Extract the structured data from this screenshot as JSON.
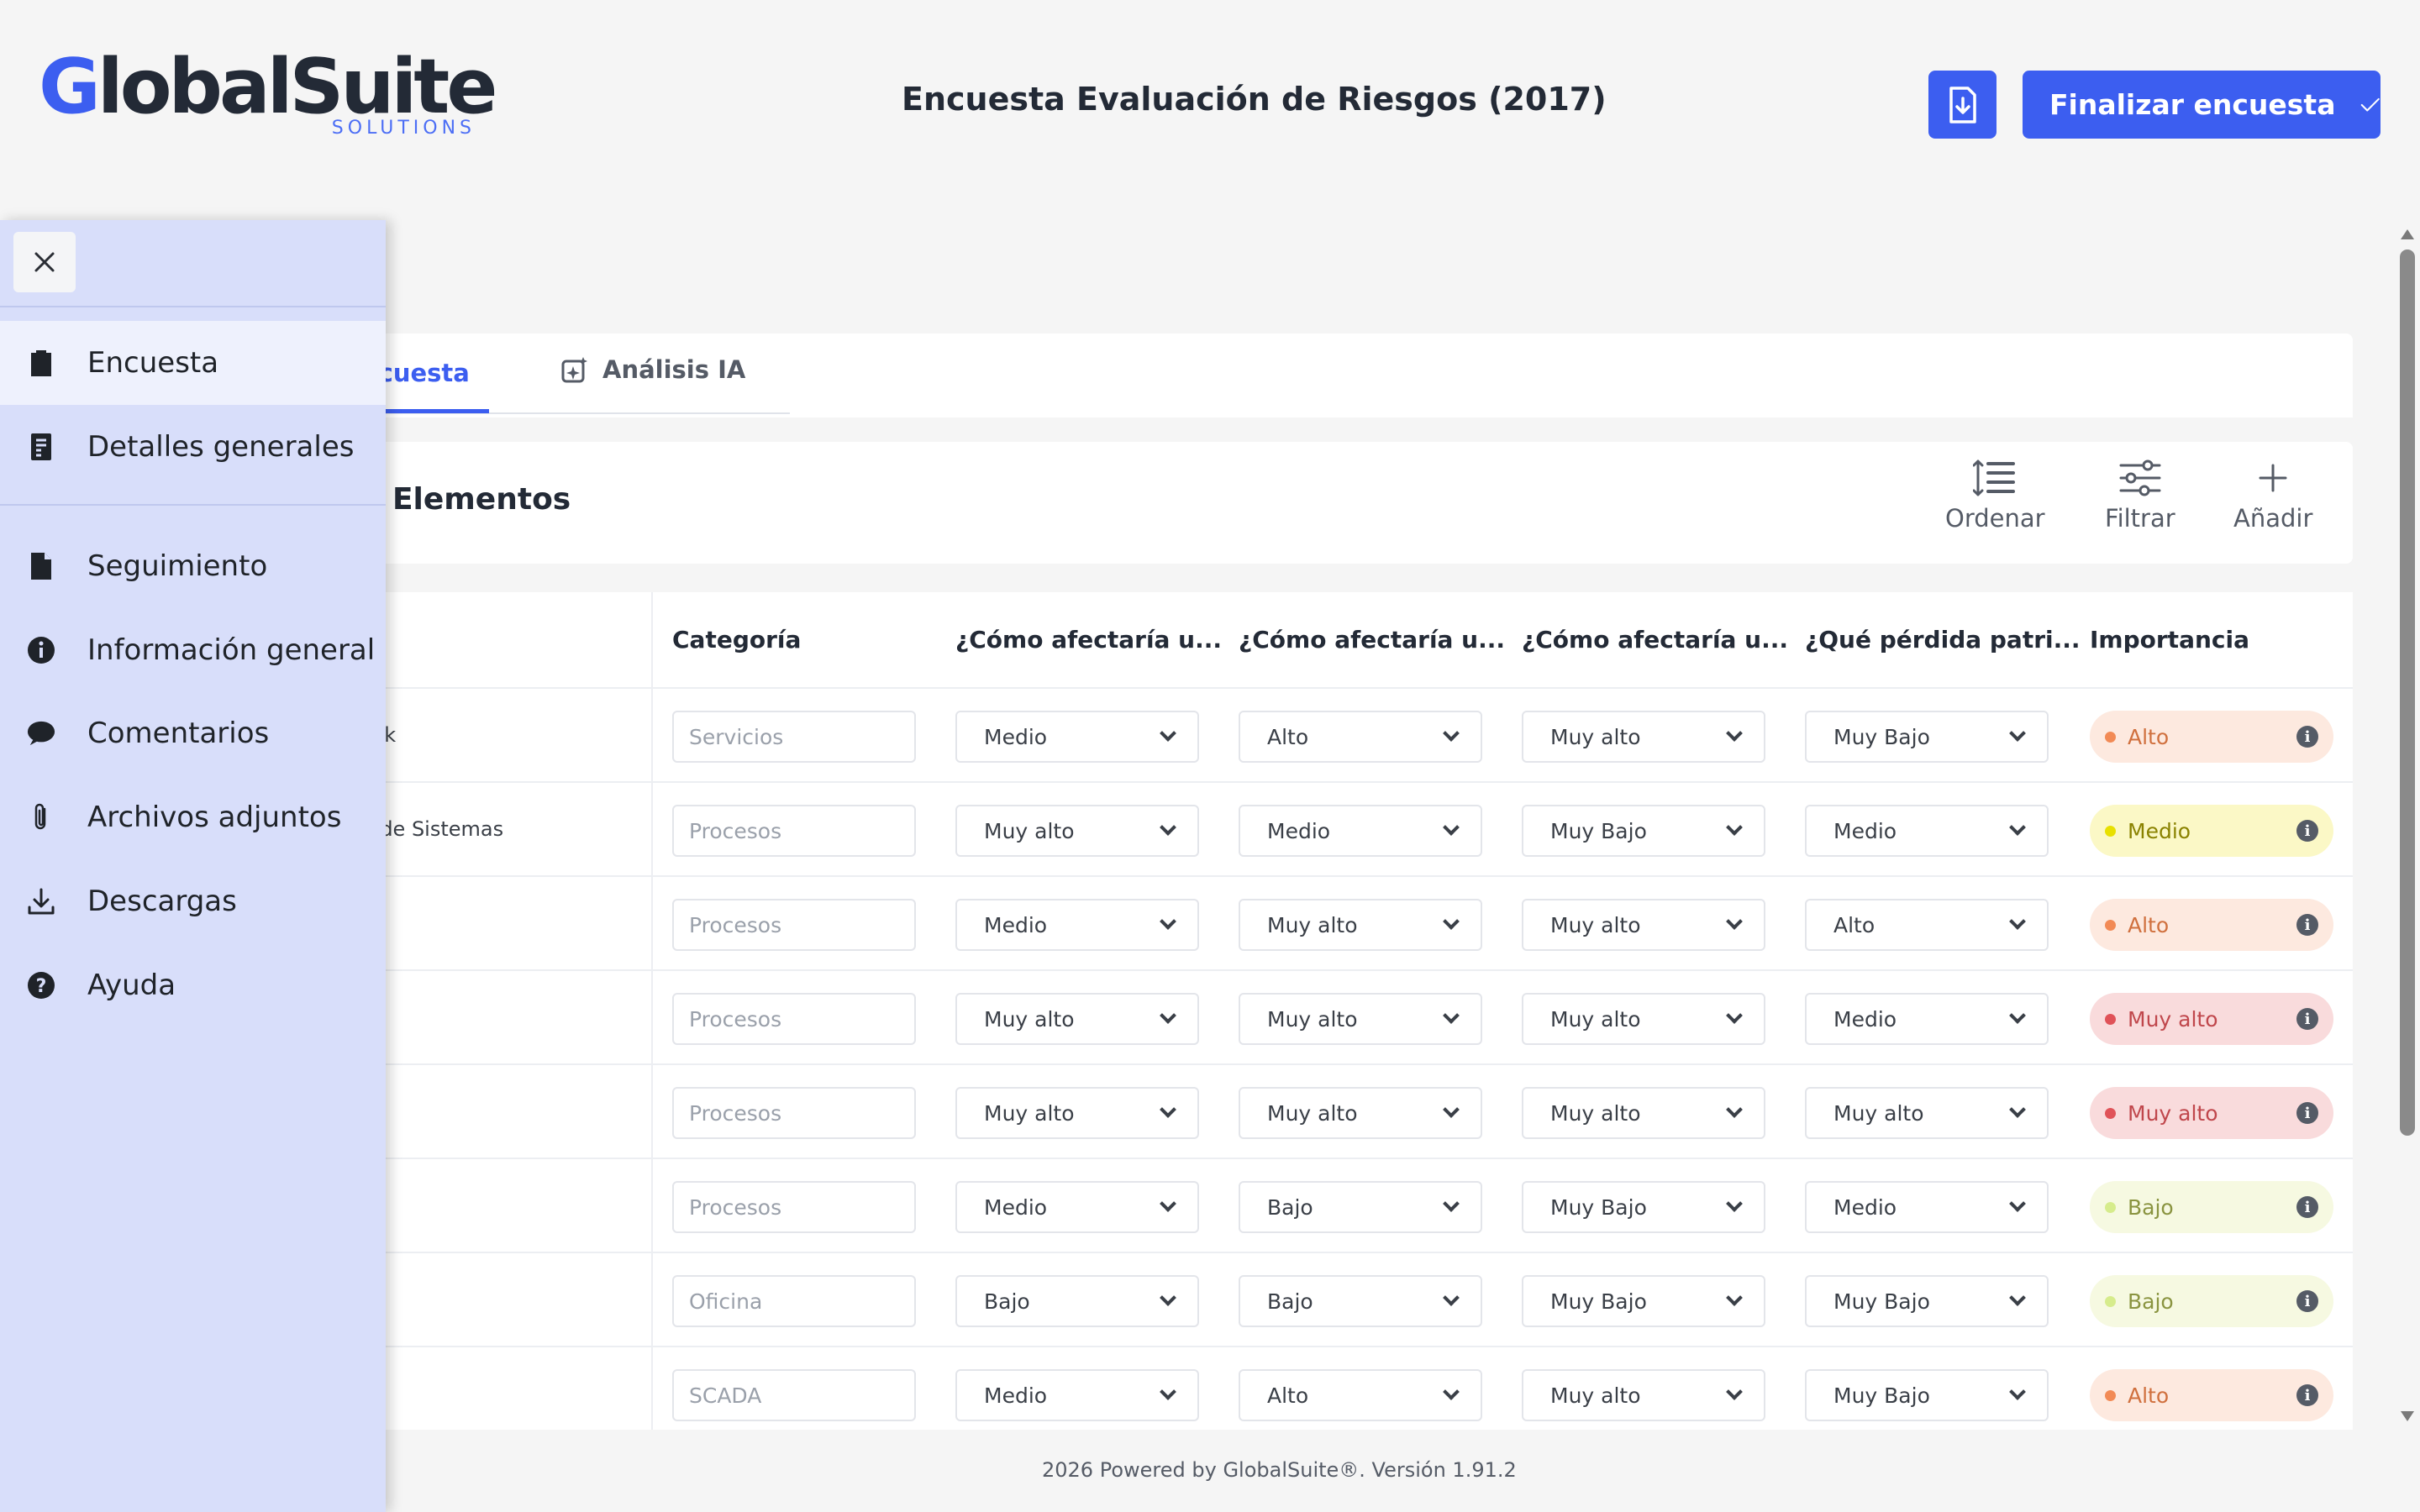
{
  "brand": {
    "name_first": "G",
    "name_rest": "lobalSuite",
    "sub": "SOLUTIONS"
  },
  "header": {
    "title": "Encuesta Evaluación de Riesgos (2017)",
    "finish_label": "Finalizar encuesta"
  },
  "tabs": [
    {
      "label": "ncuesta"
    },
    {
      "label": "Análisis IA"
    }
  ],
  "section": {
    "title": "e Elementos"
  },
  "toolbar": {
    "sort": "Ordenar",
    "filter": "Filtrar",
    "add": "Añadir"
  },
  "table": {
    "headers": [
      "Categoría",
      "¿Cómo afectaría u...",
      "¿Cómo afectaría u...",
      "¿Cómo afectaría u...",
      "¿Qué pérdida patri...",
      "Importancia"
    ],
    "rows": [
      {
        "name": "esk",
        "category": "Servicios",
        "q1": "Medio",
        "q2": "Alto",
        "q3": "Muy alto",
        "q4": "Muy Bajo",
        "importance": "Alto"
      },
      {
        "name": "o de Sistemas",
        "category": "Procesos",
        "q1": "Muy alto",
        "q2": "Medio",
        "q3": "Muy Bajo",
        "q4": "Medio",
        "importance": "Medio"
      },
      {
        "name": "",
        "category": "Procesos",
        "q1": "Medio",
        "q2": "Muy alto",
        "q3": "Muy alto",
        "q4": "Alto",
        "importance": "Alto"
      },
      {
        "name": "",
        "category": "Procesos",
        "q1": "Muy alto",
        "q2": "Muy alto",
        "q3": "Muy alto",
        "q4": "Medio",
        "importance": "Muy alto"
      },
      {
        "name": "",
        "category": "Procesos",
        "q1": "Muy alto",
        "q2": "Muy alto",
        "q3": "Muy alto",
        "q4": "Muy alto",
        "importance": "Muy alto"
      },
      {
        "name": "",
        "category": "Procesos",
        "q1": "Medio",
        "q2": "Bajo",
        "q3": "Muy Bajo",
        "q4": "Medio",
        "importance": "Bajo"
      },
      {
        "name": "",
        "category": "Oficina",
        "q1": "Bajo",
        "q2": "Bajo",
        "q3": "Muy Bajo",
        "q4": "Muy Bajo",
        "importance": "Bajo"
      },
      {
        "name": "",
        "category": "SCADA",
        "q1": "Medio",
        "q2": "Alto",
        "q3": "Muy alto",
        "q4": "Muy Bajo",
        "importance": "Alto"
      }
    ]
  },
  "importance_colors": {
    "Alto": {
      "bg": "#fde9df",
      "dot": "#f28a55",
      "text": "#d0703e"
    },
    "Medio": {
      "bg": "#fbf8c6",
      "dot": "#e8e000",
      "text": "#8a8200"
    },
    "Muy alto": {
      "bg": "#f9dbdc",
      "dot": "#e05258",
      "text": "#c0474c"
    },
    "Bajo": {
      "bg": "#f6f9e1",
      "dot": "#d6ec8c",
      "text": "#8a9440"
    }
  },
  "sidebar": {
    "items": [
      {
        "label": "Encuesta",
        "icon": "clipboard-icon"
      },
      {
        "label": "Detalles generales",
        "icon": "document-list-icon"
      },
      {
        "label": "Seguimiento",
        "icon": "file-icon"
      },
      {
        "label": "Información general",
        "icon": "info-icon"
      },
      {
        "label": "Comentarios",
        "icon": "comment-icon"
      },
      {
        "label": "Archivos adjuntos",
        "icon": "paperclip-icon"
      },
      {
        "label": "Descargas",
        "icon": "download-icon"
      },
      {
        "label": "Ayuda",
        "icon": "help-icon"
      }
    ]
  },
  "footer": {
    "text": "2026 Powered by GlobalSuite®. Versión 1.91.2"
  },
  "colors": {
    "accent": "#3c5ef0",
    "sidebar_bg": "#d8defa"
  }
}
